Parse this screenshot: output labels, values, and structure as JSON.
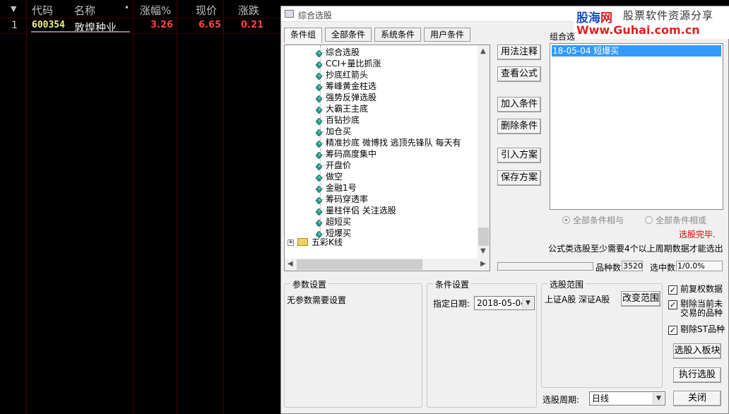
{
  "grid": {
    "headers": [
      "代码",
      "名称",
      "•",
      "涨幅%",
      "现价",
      "涨跌"
    ],
    "row": {
      "index": "1",
      "code": "600354",
      "name": "敦煌种业",
      "change_pct": "3.26",
      "price": "6.65",
      "change": "0.21"
    }
  },
  "dialog": {
    "title": "综合选股",
    "watermark": {
      "site": "股海网",
      "slogan": "股票软件资源分享",
      "url": "Www.Guhai.com.cn"
    },
    "tabs": [
      "条件组",
      "全部条件",
      "系统条件",
      "用户条件"
    ],
    "tree_items": [
      "综合选股",
      "CCI+量比抓涨",
      "抄底红箭头",
      "筹峰黄金柱选",
      "强势反弹选股",
      "大霸王主底",
      "百钻抄底",
      "加仓买",
      "精准抄底 微博找 逃顶先锋队 每天有",
      "筹码高度集中",
      "开盘价",
      "做空",
      "金融1号",
      "筹码穿透率",
      "量柱伴侣 关注选股",
      "超短买",
      "短爆买"
    ],
    "folder_label": "五彩K线",
    "buttons": {
      "formula_note": "用法注释",
      "view_formula": "查看公式",
      "add_condition": "加入条件",
      "delete_condition": "删除条件",
      "import_plan": "引入方案",
      "save_plan": "保存方案"
    },
    "combo_label": "组合选",
    "combo_items": [
      "18-05-04 短爆买"
    ],
    "radio_and": "全部条件相与",
    "radio_or": "全部条件相或",
    "done_text": "选股完毕.",
    "note_text": "公式类选股至少需要4个以上周期数据才能选出",
    "count_label": "品种数",
    "count_value": "3520",
    "selected_label": "选中数",
    "selected_value": "1/0.0%",
    "params": {
      "title": "参数设置",
      "text": "无参数需要设置"
    },
    "condition_settings": {
      "title": "条件设置",
      "date_label": "指定日期:",
      "date_value": "2018-05-04"
    },
    "range": {
      "title": "选股范围",
      "value": "上证A股 深证A股",
      "button": "改变范围"
    },
    "checkboxes": {
      "pre_adjust": "前复权数据",
      "exclude_untraded": "剔除当前未交易的品种",
      "exclude_st": "剔除ST品种"
    },
    "to_block_button": "选股入板块",
    "execute_button": "执行选股",
    "period_label": "选股周期:",
    "period_value": "日线",
    "close_button": "关闭"
  },
  "colors": {
    "code": "#f0f080",
    "name": "#f0f0f0",
    "up": "#ff4040",
    "accent": "#3399ff"
  }
}
